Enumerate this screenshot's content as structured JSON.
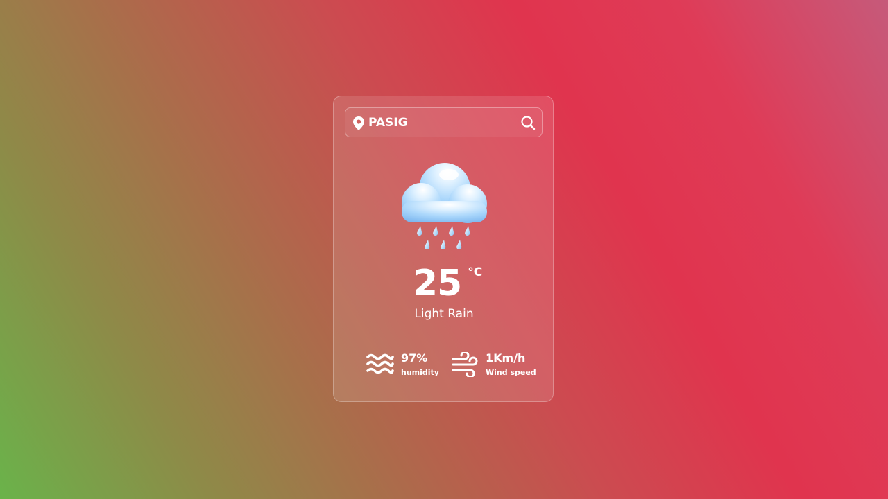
{
  "search": {
    "value": "PASIG",
    "icon": "location-pin-icon",
    "button_icon": "search-icon"
  },
  "weather": {
    "icon": "rain-cloud-icon",
    "temperature": "25",
    "unit": "°C",
    "description": "Light Rain"
  },
  "details": {
    "humidity": {
      "value": "97%",
      "label": "humidity",
      "icon": "waves-icon"
    },
    "wind": {
      "value": "1Km/h",
      "label": "Wind speed",
      "icon": "wind-icon"
    }
  },
  "colors": {
    "background_start": "#6ab34a",
    "background_mid": "#e0344e",
    "background_end": "#c65a7a",
    "text": "#ffffff",
    "cloud": "#9ecff5",
    "raindrop": "#b9dcf7"
  }
}
